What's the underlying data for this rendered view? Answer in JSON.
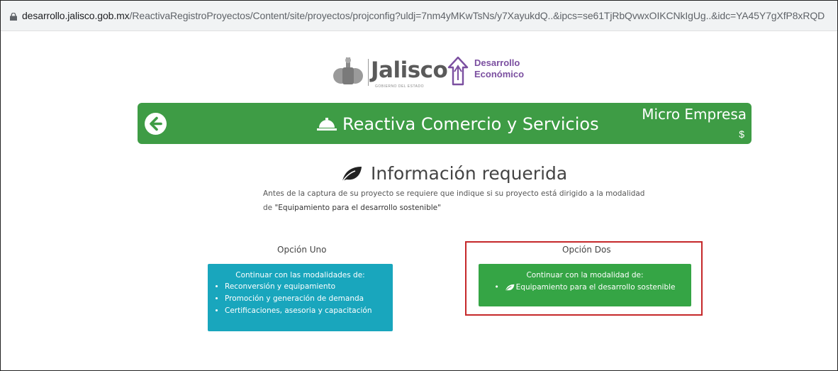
{
  "browser": {
    "url_host": "desarrollo.jalisco.gob.mx",
    "url_path": "/ReactivaRegistroProyectos/Content/site/proyectos/projconfig?uldj=7nm4yMKwTsNs/y7XayukdQ..&ipcs=se61TjRbQvwxOIKCNkIgUg..&idc=YA45Y7gXfP8xRQD"
  },
  "header": {
    "logo_jalisco": "Jalisco",
    "logo_jalisco_sub": "GOBIERNO DEL ESTADO",
    "logo_de_line1": "Desarrollo",
    "logo_de_line2": "Económico"
  },
  "banner": {
    "title": "Reactiva Comercio y Servicios",
    "tier": "Micro Empresa",
    "currency": "$"
  },
  "info": {
    "title": "Información requerida",
    "text_part1": "Antes de la captura de su proyecto se requiere que indique si su proyecto está dirigido a la modalidad de ",
    "text_quote": "\"Equipamiento para el desarrollo sostenible\""
  },
  "option1": {
    "label": "Opción Uno",
    "head": "Continuar con las modalidades de:",
    "items": [
      "Reconversión y equipamiento",
      "Promoción y generación de demanda",
      "Certificaciones, asesoria y capacitación"
    ]
  },
  "option2": {
    "label": "Opción Dos",
    "head": "Continuar con la modalidad de:",
    "item": "Equipamiento para el desarrollo sostenible"
  },
  "colors": {
    "banner": "#3e9c45",
    "option1": "#19a6bd",
    "option2": "#35a545",
    "highlight": "#c5282a"
  }
}
